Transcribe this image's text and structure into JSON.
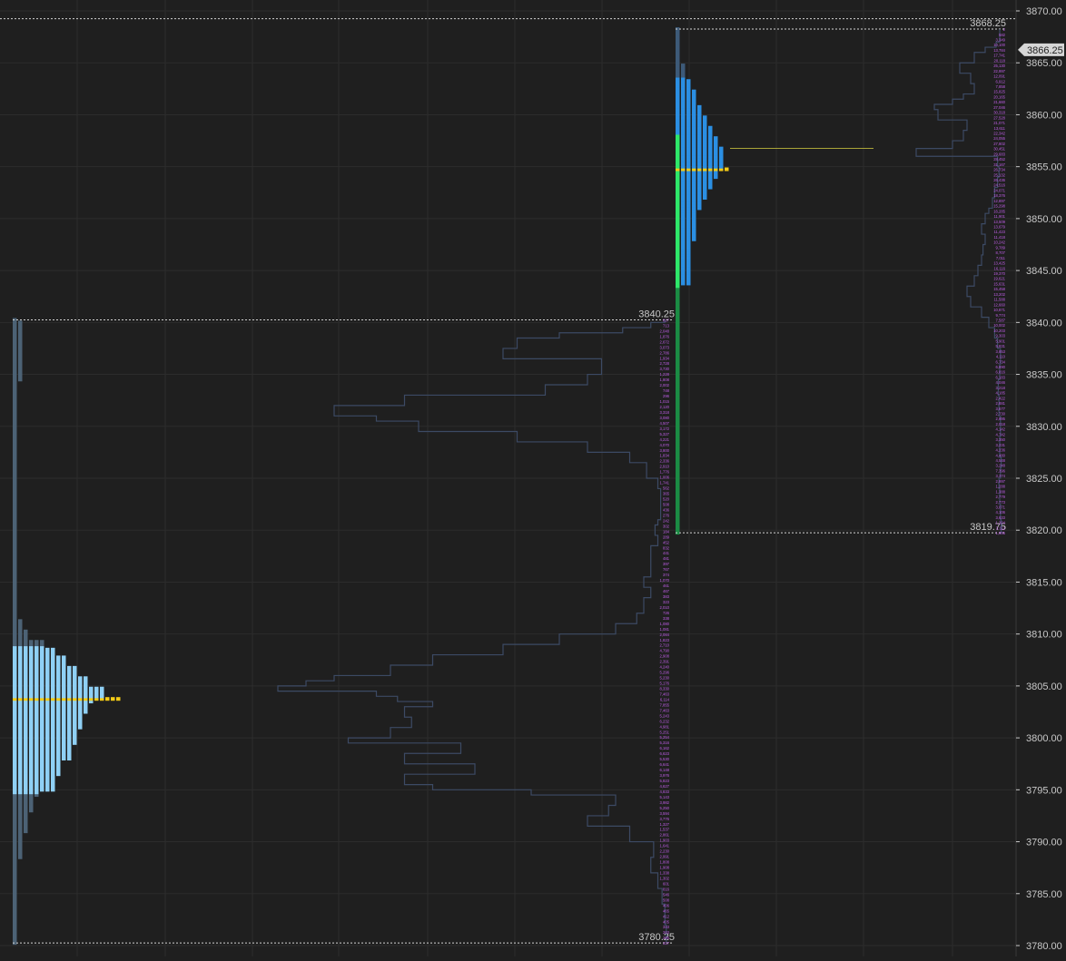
{
  "theme": {
    "background": "#1f1f1f",
    "grid": "#2c2c2c",
    "axis_text": "#c8c8c8",
    "tpo_left_bright": "#8fd0f5",
    "tpo_left_dim": "#4c6275",
    "tpo_right_bright": "#2b8fe3",
    "tpo_right_dim": "#3d5a78",
    "poc": "#f5cc16",
    "ib_green_bright": "#2ee86a",
    "ib_green_dim": "#1b8c44",
    "volume_line": "#3c4a64",
    "volume_labels": "#c05ee8",
    "ref_line": "#d4d4d4",
    "poc_line": "#d8d040",
    "price_tag_bg": "#d6d6d6",
    "price_tag_text": "#1f1f1f"
  },
  "chart_data": {
    "type": "market-profile",
    "y_axis": {
      "min": 3780,
      "max": 3870,
      "ticks": [
        "3870.00",
        "3865.00",
        "3860.00",
        "3855.00",
        "3850.00",
        "3845.00",
        "3840.00",
        "3835.00",
        "3830.00",
        "3825.00",
        "3820.00",
        "3815.00",
        "3810.00",
        "3805.00",
        "3800.00",
        "3795.00",
        "3790.00",
        "3785.00",
        "3780.00"
      ],
      "tick_values": [
        3870,
        3865,
        3860,
        3855,
        3850,
        3845,
        3840,
        3835,
        3830,
        3825,
        3820,
        3815,
        3810,
        3805,
        3800,
        3795,
        3790,
        3785,
        3780
      ]
    },
    "current_price": {
      "value": 3866.25,
      "label": "3866.25"
    },
    "top_line": 3869.25,
    "grid": true,
    "profiles": [
      {
        "name": "session-1",
        "high": 3840.25,
        "low": 3780.25,
        "high_label": "3840.25",
        "low_label": "3780.25",
        "poc": 3803.75,
        "value_area": [
          3794.75,
          3808.75
        ],
        "tpo_widths": [
          [
            3780.25,
            1
          ],
          [
            3788.0,
            1
          ],
          [
            3788.5,
            2
          ],
          [
            3791.0,
            3
          ],
          [
            3793.0,
            4
          ],
          [
            3794.5,
            5
          ],
          [
            3795.0,
            8
          ],
          [
            3796.5,
            9
          ],
          [
            3798.0,
            11
          ],
          [
            3799.5,
            12
          ],
          [
            3801.0,
            13
          ],
          [
            3802.5,
            14
          ],
          [
            3803.5,
            15
          ],
          [
            3804.0,
            17
          ],
          [
            3805.0,
            14
          ],
          [
            3806.0,
            12
          ],
          [
            3807.0,
            10
          ],
          [
            3808.0,
            8
          ],
          [
            3808.75,
            6
          ],
          [
            3809.5,
            3
          ],
          [
            3810.5,
            2
          ],
          [
            3811.5,
            1
          ],
          [
            3834.5,
            2
          ],
          [
            3840.25,
            1
          ]
        ]
      },
      {
        "name": "session-2",
        "high": 3868.25,
        "low": 3819.75,
        "high_label": "3868.25",
        "low_label": "3819.75",
        "poc": 3854.75,
        "value_area": [
          3843.75,
          3863.5
        ],
        "tpo_widths": [
          [
            3819.75,
            1
          ],
          [
            3843.5,
            1
          ],
          [
            3843.75,
            3
          ],
          [
            3846.0,
            3
          ],
          [
            3848.0,
            4
          ],
          [
            3850.0,
            4
          ],
          [
            3851.0,
            5
          ],
          [
            3852.0,
            6
          ],
          [
            3853.0,
            7
          ],
          [
            3854.0,
            8
          ],
          [
            3855.0,
            9
          ],
          [
            3856.0,
            9
          ],
          [
            3857.0,
            8
          ],
          [
            3858.0,
            7
          ],
          [
            3859.0,
            6
          ],
          [
            3860.0,
            5
          ],
          [
            3861.0,
            4
          ],
          [
            3862.5,
            3
          ],
          [
            3863.5,
            2
          ],
          [
            3865.0,
            1
          ],
          [
            3868.25,
            1
          ]
        ],
        "initial_balance": [
          3828.5,
          3858.0
        ]
      }
    ],
    "volume_profiles": [
      {
        "name": "session-1-volume",
        "points": [
          [
            3780.25,
            4
          ],
          [
            3782.0,
            4
          ],
          [
            3784.0,
            5
          ],
          [
            3785.5,
            7
          ],
          [
            3787.0,
            10
          ],
          [
            3788.5,
            15
          ],
          [
            3790.0,
            13
          ],
          [
            3791.5,
            30
          ],
          [
            3792.5,
            60
          ],
          [
            3793.5,
            45
          ],
          [
            3794.5,
            40
          ],
          [
            3795.0,
            100
          ],
          [
            3795.5,
            170
          ],
          [
            3796.5,
            190
          ],
          [
            3797.5,
            140
          ],
          [
            3798.5,
            190
          ],
          [
            3799.5,
            150
          ],
          [
            3800.0,
            230
          ],
          [
            3801.0,
            200
          ],
          [
            3802.0,
            185
          ],
          [
            3803.0,
            190
          ],
          [
            3803.5,
            170
          ],
          [
            3804.0,
            195
          ],
          [
            3804.5,
            210
          ],
          [
            3805.0,
            280
          ],
          [
            3805.5,
            260
          ],
          [
            3806.0,
            240
          ],
          [
            3807.0,
            200
          ],
          [
            3808.0,
            170
          ],
          [
            3809.0,
            120
          ],
          [
            3810.0,
            80
          ],
          [
            3811.0,
            40
          ],
          [
            3812.0,
            25
          ],
          [
            3813.5,
            20
          ],
          [
            3814.5,
            15
          ],
          [
            3815.5,
            20
          ],
          [
            3817.0,
            15
          ],
          [
            3818.5,
            15
          ],
          [
            3819.5,
            10
          ],
          [
            3820.5,
            12
          ],
          [
            3821.0,
            10
          ],
          [
            3822.5,
            8
          ],
          [
            3824.0,
            8
          ],
          [
            3825.0,
            10
          ],
          [
            3826.5,
            18
          ],
          [
            3827.5,
            30
          ],
          [
            3828.5,
            60
          ],
          [
            3829.5,
            110
          ],
          [
            3830.5,
            180
          ],
          [
            3831.0,
            210
          ],
          [
            3832.0,
            240
          ],
          [
            3833.0,
            190
          ],
          [
            3834.0,
            90
          ],
          [
            3835.0,
            60
          ],
          [
            3836.5,
            50
          ],
          [
            3837.5,
            120
          ],
          [
            3838.5,
            110
          ],
          [
            3839.0,
            80
          ],
          [
            3839.5,
            35
          ],
          [
            3840.0,
            15
          ],
          [
            3840.25,
            5
          ]
        ],
        "labels": [
          "817",
          "713",
          "2,048",
          "1,876",
          "2,672",
          "3,073",
          "2,786",
          "1,934",
          "2,728",
          "3,730",
          "1,228",
          "1,808",
          "2,002",
          "748",
          "296",
          "1,015",
          "2,120",
          "3,318",
          "3,080",
          "4,507",
          "3,172",
          "5,327",
          "4,221",
          "4,070",
          "3,800",
          "1,834",
          "2,336",
          "2,910",
          "1,776",
          "1,006",
          "1,741",
          "562",
          "365",
          "520",
          "508",
          "436",
          "276",
          "242",
          "302",
          "184",
          "289",
          "452",
          "832",
          "441",
          "481",
          "397",
          "767",
          "374",
          "1,070",
          "461",
          "467",
          "383",
          "323",
          "2,010",
          "726",
          "338",
          "1,080",
          "1,081",
          "2,084",
          "1,823",
          "2,710",
          "4,790",
          "2,908",
          "2,391",
          "4,240",
          "5,296",
          "5,230",
          "5,176",
          "8,330",
          "7,463",
          "6,114",
          "7,855",
          "7,463",
          "5,243",
          "6,232",
          "4,981",
          "5,251",
          "5,254",
          "5,316",
          "6,162",
          "6,623",
          "5,530",
          "6,641",
          "6,148",
          "3,976",
          "5,823",
          "4,627",
          "4,833",
          "5,143",
          "3,982",
          "5,250",
          "3,594",
          "3,776",
          "1,327",
          "1,537",
          "2,861",
          "1,903",
          "1,641",
          "2,230",
          "2,991",
          "1,808",
          "1,908",
          "1,338",
          "1,302",
          "601",
          "816",
          "546",
          "508",
          "406",
          "465",
          "412",
          "405",
          "343",
          "263",
          "265",
          "317"
        ]
      },
      {
        "name": "session-2-volume",
        "points": [
          [
            3819.75,
            2
          ],
          [
            3821.0,
            3
          ],
          [
            3822.5,
            4
          ],
          [
            3824.0,
            5
          ],
          [
            3825.0,
            6
          ],
          [
            3826.0,
            4
          ],
          [
            3827.0,
            3
          ],
          [
            3829.0,
            5
          ],
          [
            3831.0,
            4
          ],
          [
            3833.0,
            6
          ],
          [
            3834.5,
            7
          ],
          [
            3836.0,
            5
          ],
          [
            3837.5,
            4
          ],
          [
            3838.5,
            8
          ],
          [
            3839.5,
            12
          ],
          [
            3840.5,
            20
          ],
          [
            3841.5,
            30
          ],
          [
            3842.5,
            45
          ],
          [
            3843.5,
            50
          ],
          [
            3844.5,
            40
          ],
          [
            3845.5,
            35
          ],
          [
            3846.5,
            30
          ],
          [
            3847.5,
            28
          ],
          [
            3848.5,
            25
          ],
          [
            3849.5,
            30
          ],
          [
            3850.5,
            25
          ],
          [
            3851.0,
            20
          ],
          [
            3852.0,
            15
          ],
          [
            3853.0,
            12
          ],
          [
            3854.0,
            8
          ],
          [
            3855.0,
            6
          ],
          [
            3856.0,
            8
          ],
          [
            3856.75,
            120
          ],
          [
            3857.5,
            70
          ],
          [
            3858.5,
            55
          ],
          [
            3859.5,
            50
          ],
          [
            3860.5,
            90
          ],
          [
            3861.0,
            95
          ],
          [
            3861.5,
            70
          ],
          [
            3862.0,
            55
          ],
          [
            3863.0,
            40
          ],
          [
            3864.0,
            45
          ],
          [
            3865.0,
            60
          ],
          [
            3866.0,
            40
          ],
          [
            3866.5,
            25
          ],
          [
            3867.0,
            10
          ],
          [
            3868.25,
            5
          ]
        ],
        "labels": [
          "2",
          "582",
          "3,349",
          "10,100",
          "13,784",
          "17,741",
          "20,118",
          "25,130",
          "22,997",
          "12,091",
          "6,912",
          "7,858",
          "15,825",
          "20,165",
          "21,660",
          "27,046",
          "30,318",
          "27,528",
          "21,071",
          "13,611",
          "22,342",
          "24,055",
          "27,802",
          "30,451",
          "29,683",
          "28,452",
          "31,167",
          "26,734",
          "25,132",
          "26,436",
          "24,516",
          "24,071",
          "18,376",
          "12,897",
          "15,298",
          "16,285",
          "11,901",
          "13,509",
          "13,679",
          "11,423",
          "11,418",
          "10,242",
          "9,789",
          "8,707",
          "7,011",
          "13,425",
          "16,116",
          "19,370",
          "19,621",
          "15,631",
          "15,458",
          "13,202",
          "11,588",
          "12,660",
          "10,871",
          "9,774",
          "7,587",
          "10,002",
          "10,203",
          "9,303",
          "5,901",
          "5,831",
          "3,853",
          "4,110",
          "6,734",
          "6,890",
          "6,816",
          "6,183",
          "4,046",
          "3,218",
          "4,185",
          "2,422",
          "2,881",
          "3,677",
          "2,730",
          "2,895",
          "2,018",
          "4,142",
          "4,742",
          "3,350",
          "3,231",
          "4,236",
          "4,480",
          "4,548",
          "3,248",
          "7,396",
          "3,374",
          "2,997",
          "1,288",
          "1,388",
          "2,779",
          "2,773",
          "3,071",
          "4,106",
          "3,633",
          "1,304",
          "3,112",
          "1,905"
        ]
      }
    ]
  }
}
